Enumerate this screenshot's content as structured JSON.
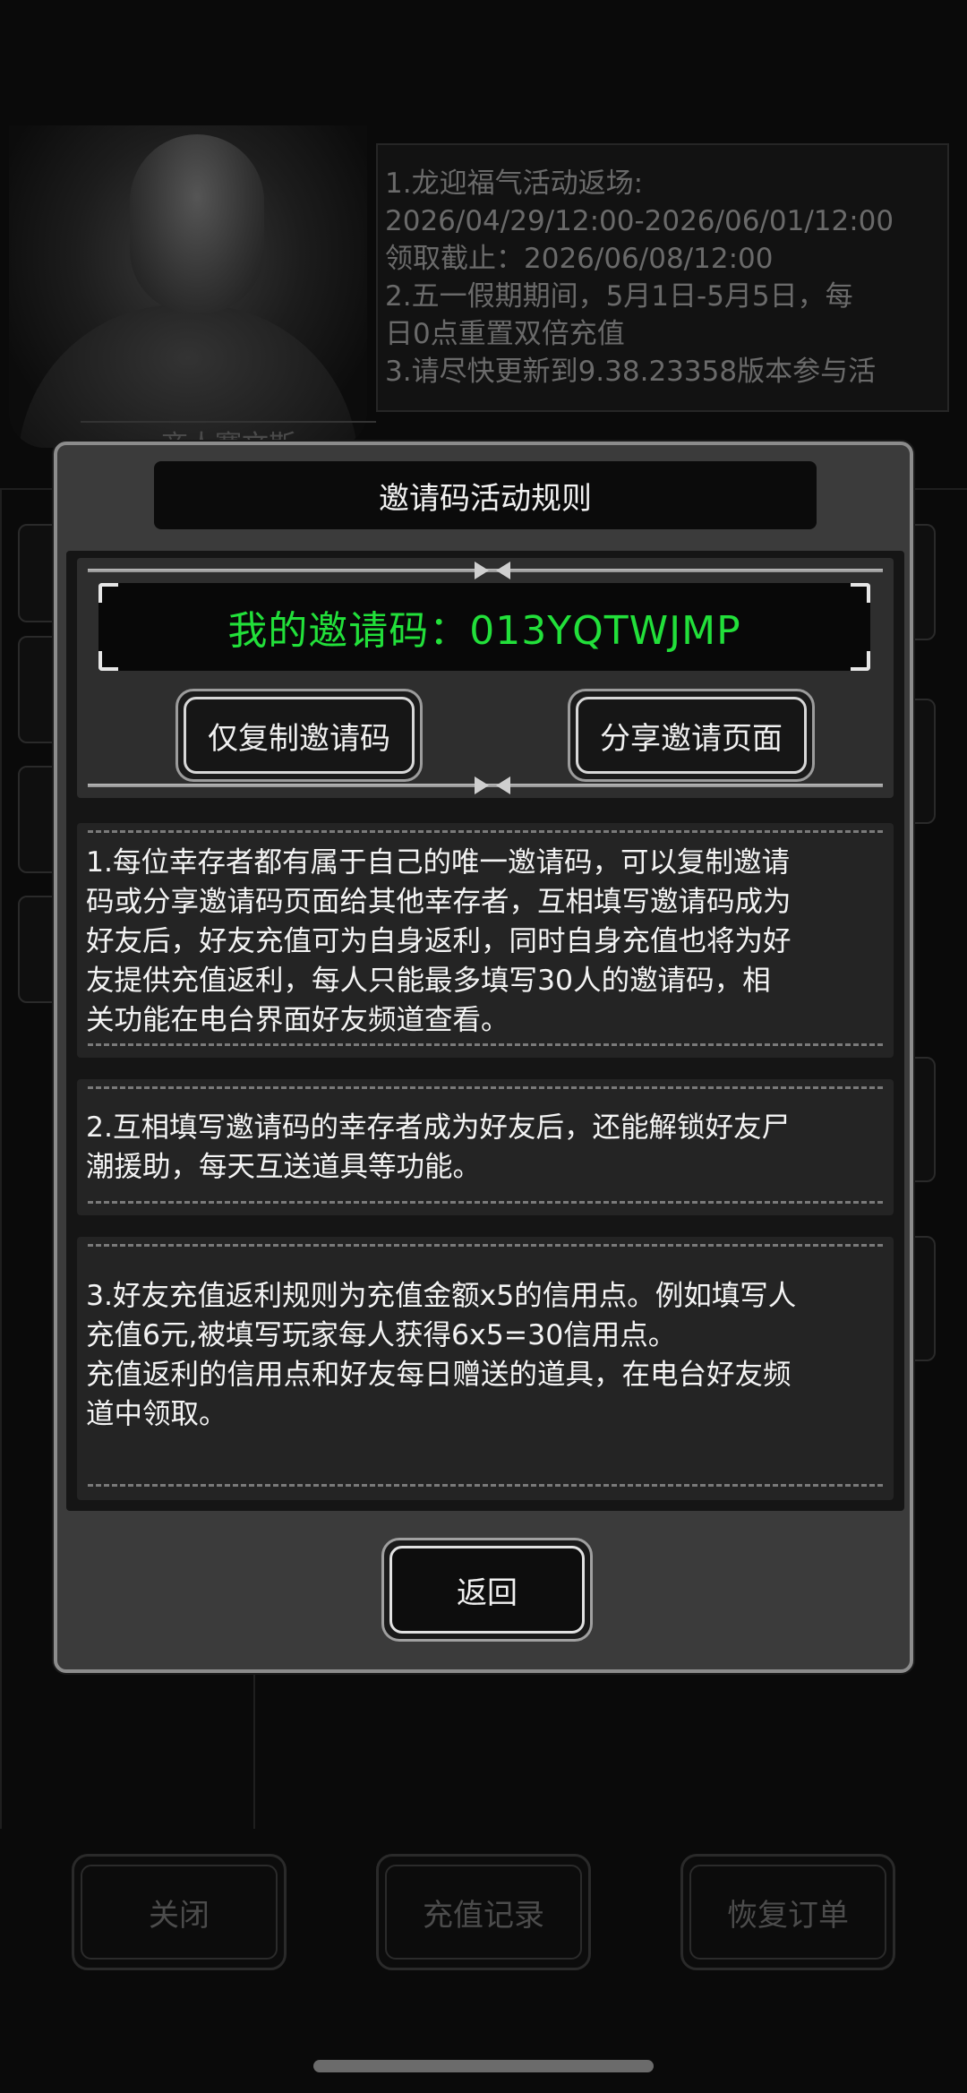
{
  "background": {
    "character_name": "商人赛文斯",
    "notice_lines": [
      "1.龙迎福气活动返场:",
      "2026/04/29/12:00-2026/06/01/12:00",
      "领取截止：2026/06/08/12:00",
      "2.五一假期期间，5月1日-5月5日，每",
      "日0点重置双倍充值",
      "3.请尽快更新到9.38.23358版本参与活"
    ],
    "bottom_buttons": {
      "close": "关闭",
      "recharge_history": "充值记录",
      "restore_order": "恢复订单"
    }
  },
  "modal": {
    "title": "邀请码活动规则",
    "invite_code_text": "我的邀请码：013YQTWJMP",
    "copy_button": "仅复制邀请码",
    "share_button": "分享邀请页面",
    "rules": [
      {
        "lines": [
          "1.每位幸存者都有属于自己的唯一邀请码，可以复制邀请",
          "码或分享邀请码页面给其他幸存者，互相填写邀请码成为",
          "好友后，好友充值可为自身返利，同时自身充值也将为好",
          "友提供充值返利，每人只能最多填写30人的邀请码，相",
          "关功能在电台界面好友频道查看。"
        ]
      },
      {
        "lines": [
          "2.互相填写邀请码的幸存者成为好友后，还能解锁好友尸",
          "潮援助，每天互送道具等功能。"
        ]
      },
      {
        "lines": [
          "3.好友充值返利规则为充值金额x5的信用点。例如填写人",
          "充值6元,被填写玩家每人获得6x5=30信用点。",
          "充值返利的信用点和好友每日赠送的道具，在电台好友频",
          "道中领取。"
        ]
      }
    ],
    "back_button": "返回"
  },
  "colors": {
    "invite_code": "#22e03a",
    "modal_bg": "#3b3b3b",
    "modal_border": "#8c8c8c"
  }
}
